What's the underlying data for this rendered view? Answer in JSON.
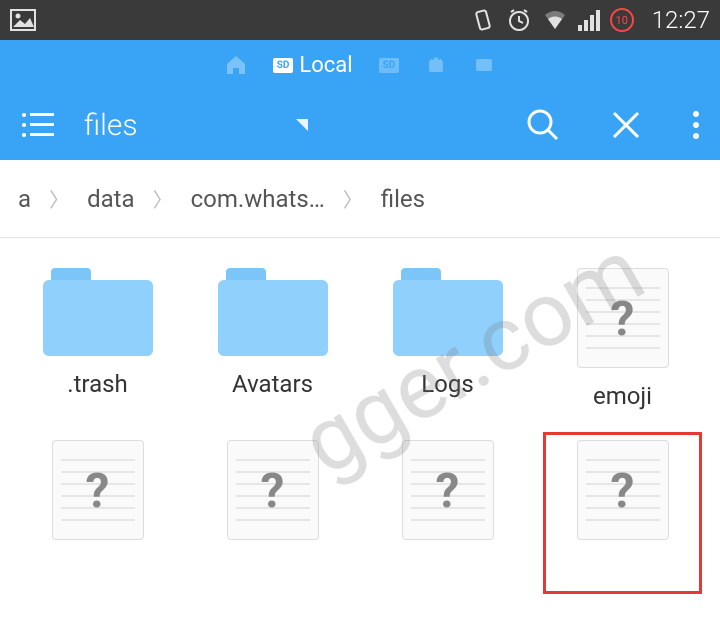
{
  "status": {
    "time": "12:27",
    "badge": "10"
  },
  "tabs": {
    "local_label": "Local"
  },
  "toolbar": {
    "title": "files"
  },
  "breadcrumb": {
    "items": [
      "a",
      "data",
      "com.whats…",
      "files"
    ]
  },
  "grid": {
    "items": [
      {
        "type": "folder",
        "label": ".trash"
      },
      {
        "type": "folder",
        "label": "Avatars"
      },
      {
        "type": "folder",
        "label": "Logs"
      },
      {
        "type": "file",
        "label": "emoji"
      },
      {
        "type": "file",
        "label": ""
      },
      {
        "type": "file",
        "label": ""
      },
      {
        "type": "file",
        "label": ""
      },
      {
        "type": "file",
        "label": "",
        "highlighted": true
      }
    ]
  },
  "watermark": "gger.com"
}
